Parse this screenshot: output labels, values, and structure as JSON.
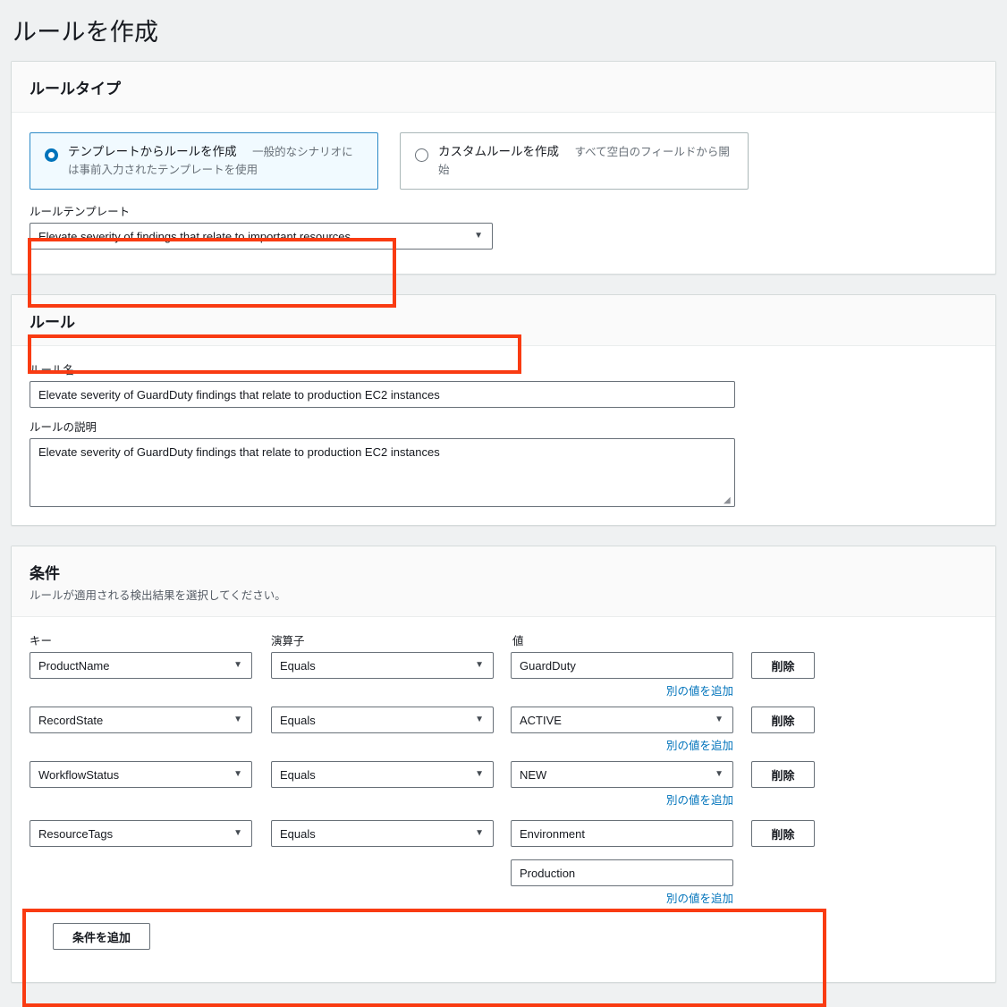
{
  "page": {
    "title": "ルールを作成"
  },
  "rule_type_panel": {
    "heading": "ルールタイプ",
    "options": [
      {
        "label": "テンプレートからルールを作成",
        "description": "一般的なシナリオには事前入力されたテンプレートを使用",
        "selected": true
      },
      {
        "label": "カスタムルールを作成",
        "description": "すべて空白のフィールドから開始",
        "selected": false
      }
    ],
    "template_field": {
      "label": "ルールテンプレート",
      "value": "Elevate severity of findings that relate to important resources",
      "caret": "▼"
    }
  },
  "rule_panel": {
    "heading": "ルール",
    "name_field": {
      "label": "ルール名",
      "value": "Elevate severity of GuardDuty findings that relate to production EC2 instances"
    },
    "description_field": {
      "label": "ルールの説明",
      "value": "Elevate severity of GuardDuty findings that relate to production EC2 instances"
    }
  },
  "conditions_panel": {
    "heading": "条件",
    "subtitle": "ルールが適用される検出結果を選択してください。",
    "columns": {
      "key": "キー",
      "operator": "演算子",
      "value": "値"
    },
    "add_value_label": "別の値を追加",
    "delete_label": "削除",
    "add_condition_label": "条件を追加",
    "caret": "▼",
    "rows": [
      {
        "key": "ProductName",
        "operator": "Equals",
        "values": [
          {
            "text": "GuardDuty",
            "is_select": false
          }
        ],
        "highlighted": false
      },
      {
        "key": "RecordState",
        "operator": "Equals",
        "values": [
          {
            "text": "ACTIVE",
            "is_select": true
          }
        ],
        "highlighted": false
      },
      {
        "key": "WorkflowStatus",
        "operator": "Equals",
        "values": [
          {
            "text": "NEW",
            "is_select": true
          }
        ],
        "highlighted": false
      },
      {
        "key": "ResourceTags",
        "operator": "Equals",
        "values": [
          {
            "text": "Environment",
            "is_select": false
          },
          {
            "text": "Production",
            "is_select": false
          }
        ],
        "highlighted": true
      }
    ]
  },
  "colors": {
    "highlight": "#f93b12",
    "link": "#0073bb",
    "accent": "#0073bb",
    "page_bg": "#eff1f2",
    "panel_bg": "#ffffff",
    "panel_header_bg": "#fafafa"
  }
}
